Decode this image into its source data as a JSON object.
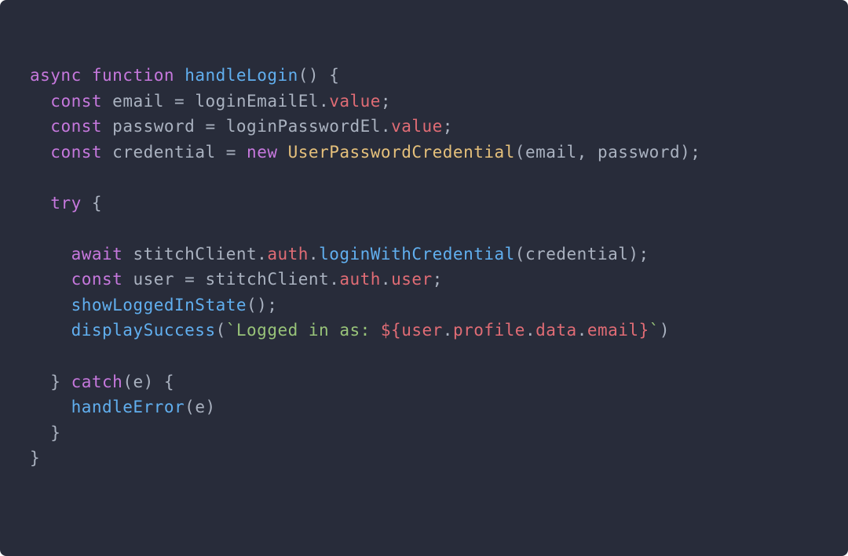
{
  "code": {
    "lines": [
      {
        "indent": 0,
        "tokens": [
          [
            "keyword",
            "async"
          ],
          [
            "punct",
            " "
          ],
          [
            "keyword",
            "function"
          ],
          [
            "punct",
            " "
          ],
          [
            "funcname",
            "handleLogin"
          ],
          [
            "punct",
            "()"
          ],
          [
            "punct",
            " {"
          ]
        ]
      },
      {
        "indent": 1,
        "tokens": [
          [
            "keyword",
            "const"
          ],
          [
            "punct",
            " "
          ],
          [
            "ident",
            "email"
          ],
          [
            "punct",
            " = "
          ],
          [
            "ident",
            "loginEmailEl"
          ],
          [
            "punct",
            "."
          ],
          [
            "prop",
            "value"
          ],
          [
            "punct",
            ";"
          ]
        ]
      },
      {
        "indent": 1,
        "tokens": [
          [
            "keyword",
            "const"
          ],
          [
            "punct",
            " "
          ],
          [
            "ident",
            "password"
          ],
          [
            "punct",
            " = "
          ],
          [
            "ident",
            "loginPasswordEl"
          ],
          [
            "punct",
            "."
          ],
          [
            "prop",
            "value"
          ],
          [
            "punct",
            ";"
          ]
        ]
      },
      {
        "indent": 1,
        "tokens": [
          [
            "keyword",
            "const"
          ],
          [
            "punct",
            " "
          ],
          [
            "ident",
            "credential"
          ],
          [
            "punct",
            " = "
          ],
          [
            "keyword",
            "new"
          ],
          [
            "punct",
            " "
          ],
          [
            "class",
            "UserPasswordCredential"
          ],
          [
            "punct",
            "("
          ],
          [
            "ident",
            "email"
          ],
          [
            "punct",
            ", "
          ],
          [
            "ident",
            "password"
          ],
          [
            "punct",
            ");"
          ]
        ]
      },
      {
        "indent": 0,
        "tokens": []
      },
      {
        "indent": 1,
        "tokens": [
          [
            "keyword",
            "try"
          ],
          [
            "punct",
            " {"
          ]
        ]
      },
      {
        "indent": 0,
        "tokens": []
      },
      {
        "indent": 2,
        "tokens": [
          [
            "keyword",
            "await"
          ],
          [
            "punct",
            " "
          ],
          [
            "ident",
            "stitchClient"
          ],
          [
            "punct",
            "."
          ],
          [
            "prop",
            "auth"
          ],
          [
            "punct",
            "."
          ],
          [
            "call",
            "loginWithCredential"
          ],
          [
            "punct",
            "("
          ],
          [
            "ident",
            "credential"
          ],
          [
            "punct",
            ");"
          ]
        ]
      },
      {
        "indent": 2,
        "tokens": [
          [
            "keyword",
            "const"
          ],
          [
            "punct",
            " "
          ],
          [
            "ident",
            "user"
          ],
          [
            "punct",
            " = "
          ],
          [
            "ident",
            "stitchClient"
          ],
          [
            "punct",
            "."
          ],
          [
            "prop",
            "auth"
          ],
          [
            "punct",
            "."
          ],
          [
            "prop",
            "user"
          ],
          [
            "punct",
            ";"
          ]
        ]
      },
      {
        "indent": 2,
        "tokens": [
          [
            "call",
            "showLoggedInState"
          ],
          [
            "punct",
            "();"
          ]
        ]
      },
      {
        "indent": 2,
        "tokens": [
          [
            "call",
            "displaySuccess"
          ],
          [
            "punct",
            "("
          ],
          [
            "string",
            "`Logged in as: "
          ],
          [
            "interpdelim",
            "${"
          ],
          [
            "interpexpr",
            "user"
          ],
          [
            "punct",
            "."
          ],
          [
            "interpexpr",
            "profile"
          ],
          [
            "punct",
            "."
          ],
          [
            "interpexpr",
            "data"
          ],
          [
            "punct",
            "."
          ],
          [
            "interpexpr",
            "email"
          ],
          [
            "interpdelim",
            "}"
          ],
          [
            "string",
            "`"
          ],
          [
            "punct",
            ")"
          ]
        ]
      },
      {
        "indent": 0,
        "tokens": []
      },
      {
        "indent": 1,
        "tokens": [
          [
            "punct",
            "} "
          ],
          [
            "keyword",
            "catch"
          ],
          [
            "punct",
            "("
          ],
          [
            "ident",
            "e"
          ],
          [
            "punct",
            ") {"
          ]
        ]
      },
      {
        "indent": 2,
        "tokens": [
          [
            "call",
            "handleError"
          ],
          [
            "punct",
            "("
          ],
          [
            "ident",
            "e"
          ],
          [
            "punct",
            ")"
          ]
        ]
      },
      {
        "indent": 1,
        "tokens": [
          [
            "punct",
            "}"
          ]
        ]
      },
      {
        "indent": 0,
        "tokens": [
          [
            "punct",
            "}"
          ]
        ]
      }
    ]
  }
}
